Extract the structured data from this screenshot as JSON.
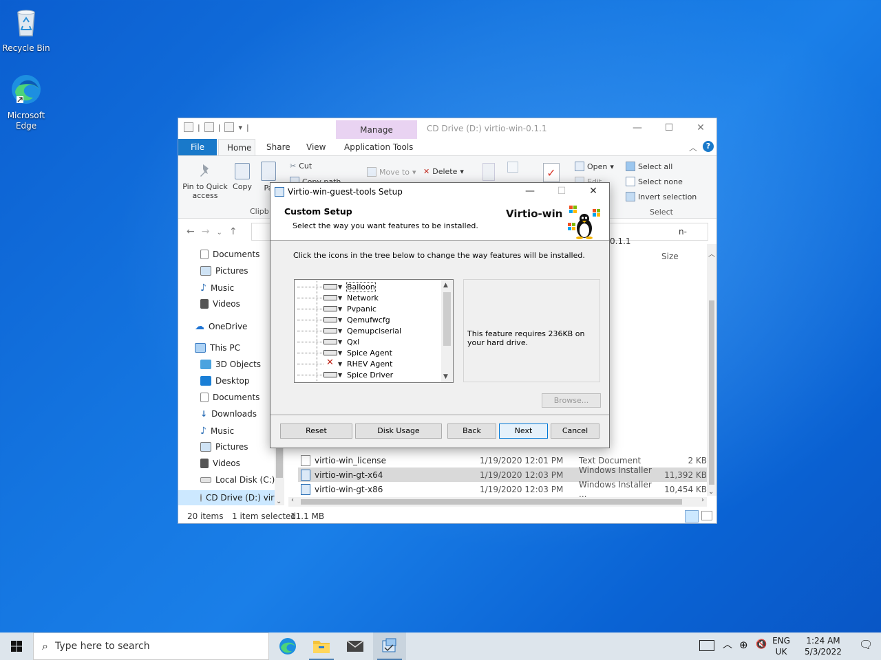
{
  "desktop": {
    "icons": [
      {
        "label": "Recycle Bin",
        "icon": "recycle-bin-icon"
      },
      {
        "label": "Microsoft Edge",
        "icon": "edge-icon"
      }
    ]
  },
  "explorer": {
    "title": "CD Drive (D:) virtio-win-0.1.1",
    "contextual_tab": "Manage",
    "tabs": [
      "File",
      "Home",
      "Share",
      "View",
      "Application Tools"
    ],
    "ribbon": {
      "pin_label": "Pin to Quick access",
      "copy": "Copy",
      "paste": "Pa",
      "cut": "Cut",
      "copy_path": "Copy path",
      "clipboard_group": "Clipb",
      "move_to": "Move to",
      "delete": "Delete",
      "open": "Open",
      "edit": "Edit",
      "select_all": "Select all",
      "select_none": "Select none",
      "invert_selection": "Invert selection",
      "select_group": "Select"
    },
    "address_tail": "n-0.1.1",
    "size_header": "Size",
    "nav": [
      {
        "label": "Documents"
      },
      {
        "label": "Pictures"
      },
      {
        "label": "Music"
      },
      {
        "label": "Videos"
      },
      {
        "label": "OneDrive"
      },
      {
        "label": "This PC"
      },
      {
        "label": "3D Objects"
      },
      {
        "label": "Desktop"
      },
      {
        "label": "Documents"
      },
      {
        "label": "Downloads"
      },
      {
        "label": "Music"
      },
      {
        "label": "Pictures"
      },
      {
        "label": "Videos"
      },
      {
        "label": "Local Disk (C:)"
      },
      {
        "label": "CD Drive (D:) virt"
      }
    ],
    "files": [
      {
        "name": "virtio-win_license",
        "date": "1/19/2020 12:01 PM",
        "type": "Text Document",
        "size": "2 KB"
      },
      {
        "name": "virtio-win-gt-x64",
        "date": "1/19/2020 12:03 PM",
        "type": "Windows Installer ...",
        "size": "11,392 KB"
      },
      {
        "name": "virtio-win-gt-x86",
        "date": "1/19/2020 12:03 PM",
        "type": "Windows Installer ...",
        "size": "10,454 KB"
      }
    ],
    "status": {
      "items": "20 items",
      "selected": "1 item selected",
      "size": "11.1 MB"
    }
  },
  "setup": {
    "title": "Virtio-win-guest-tools Setup",
    "heading": "Custom Setup",
    "subheading": "Select the way you want features to be installed.",
    "brand": "Virtio-win",
    "instruction": "Click the icons in the tree below to change the way features will be installed.",
    "features": [
      {
        "label": "Balloon",
        "state": "install"
      },
      {
        "label": "Network",
        "state": "install"
      },
      {
        "label": "Pvpanic",
        "state": "install"
      },
      {
        "label": "Qemufwcfg",
        "state": "install"
      },
      {
        "label": "Qemupciserial",
        "state": "install"
      },
      {
        "label": "Qxl",
        "state": "install"
      },
      {
        "label": "Spice Agent",
        "state": "install"
      },
      {
        "label": "RHEV Agent",
        "state": "unavailable"
      },
      {
        "label": "Spice Driver",
        "state": "install"
      }
    ],
    "description": "This feature requires 236KB on your hard drive.",
    "browse": "Browse...",
    "buttons": {
      "reset": "Reset",
      "disk_usage": "Disk Usage",
      "back": "Back",
      "next": "Next",
      "cancel": "Cancel"
    }
  },
  "taskbar": {
    "search_placeholder": "Type here to search",
    "lang_top": "ENG",
    "lang_bottom": "UK",
    "time": "1:24 AM",
    "date": "5/3/2022"
  }
}
